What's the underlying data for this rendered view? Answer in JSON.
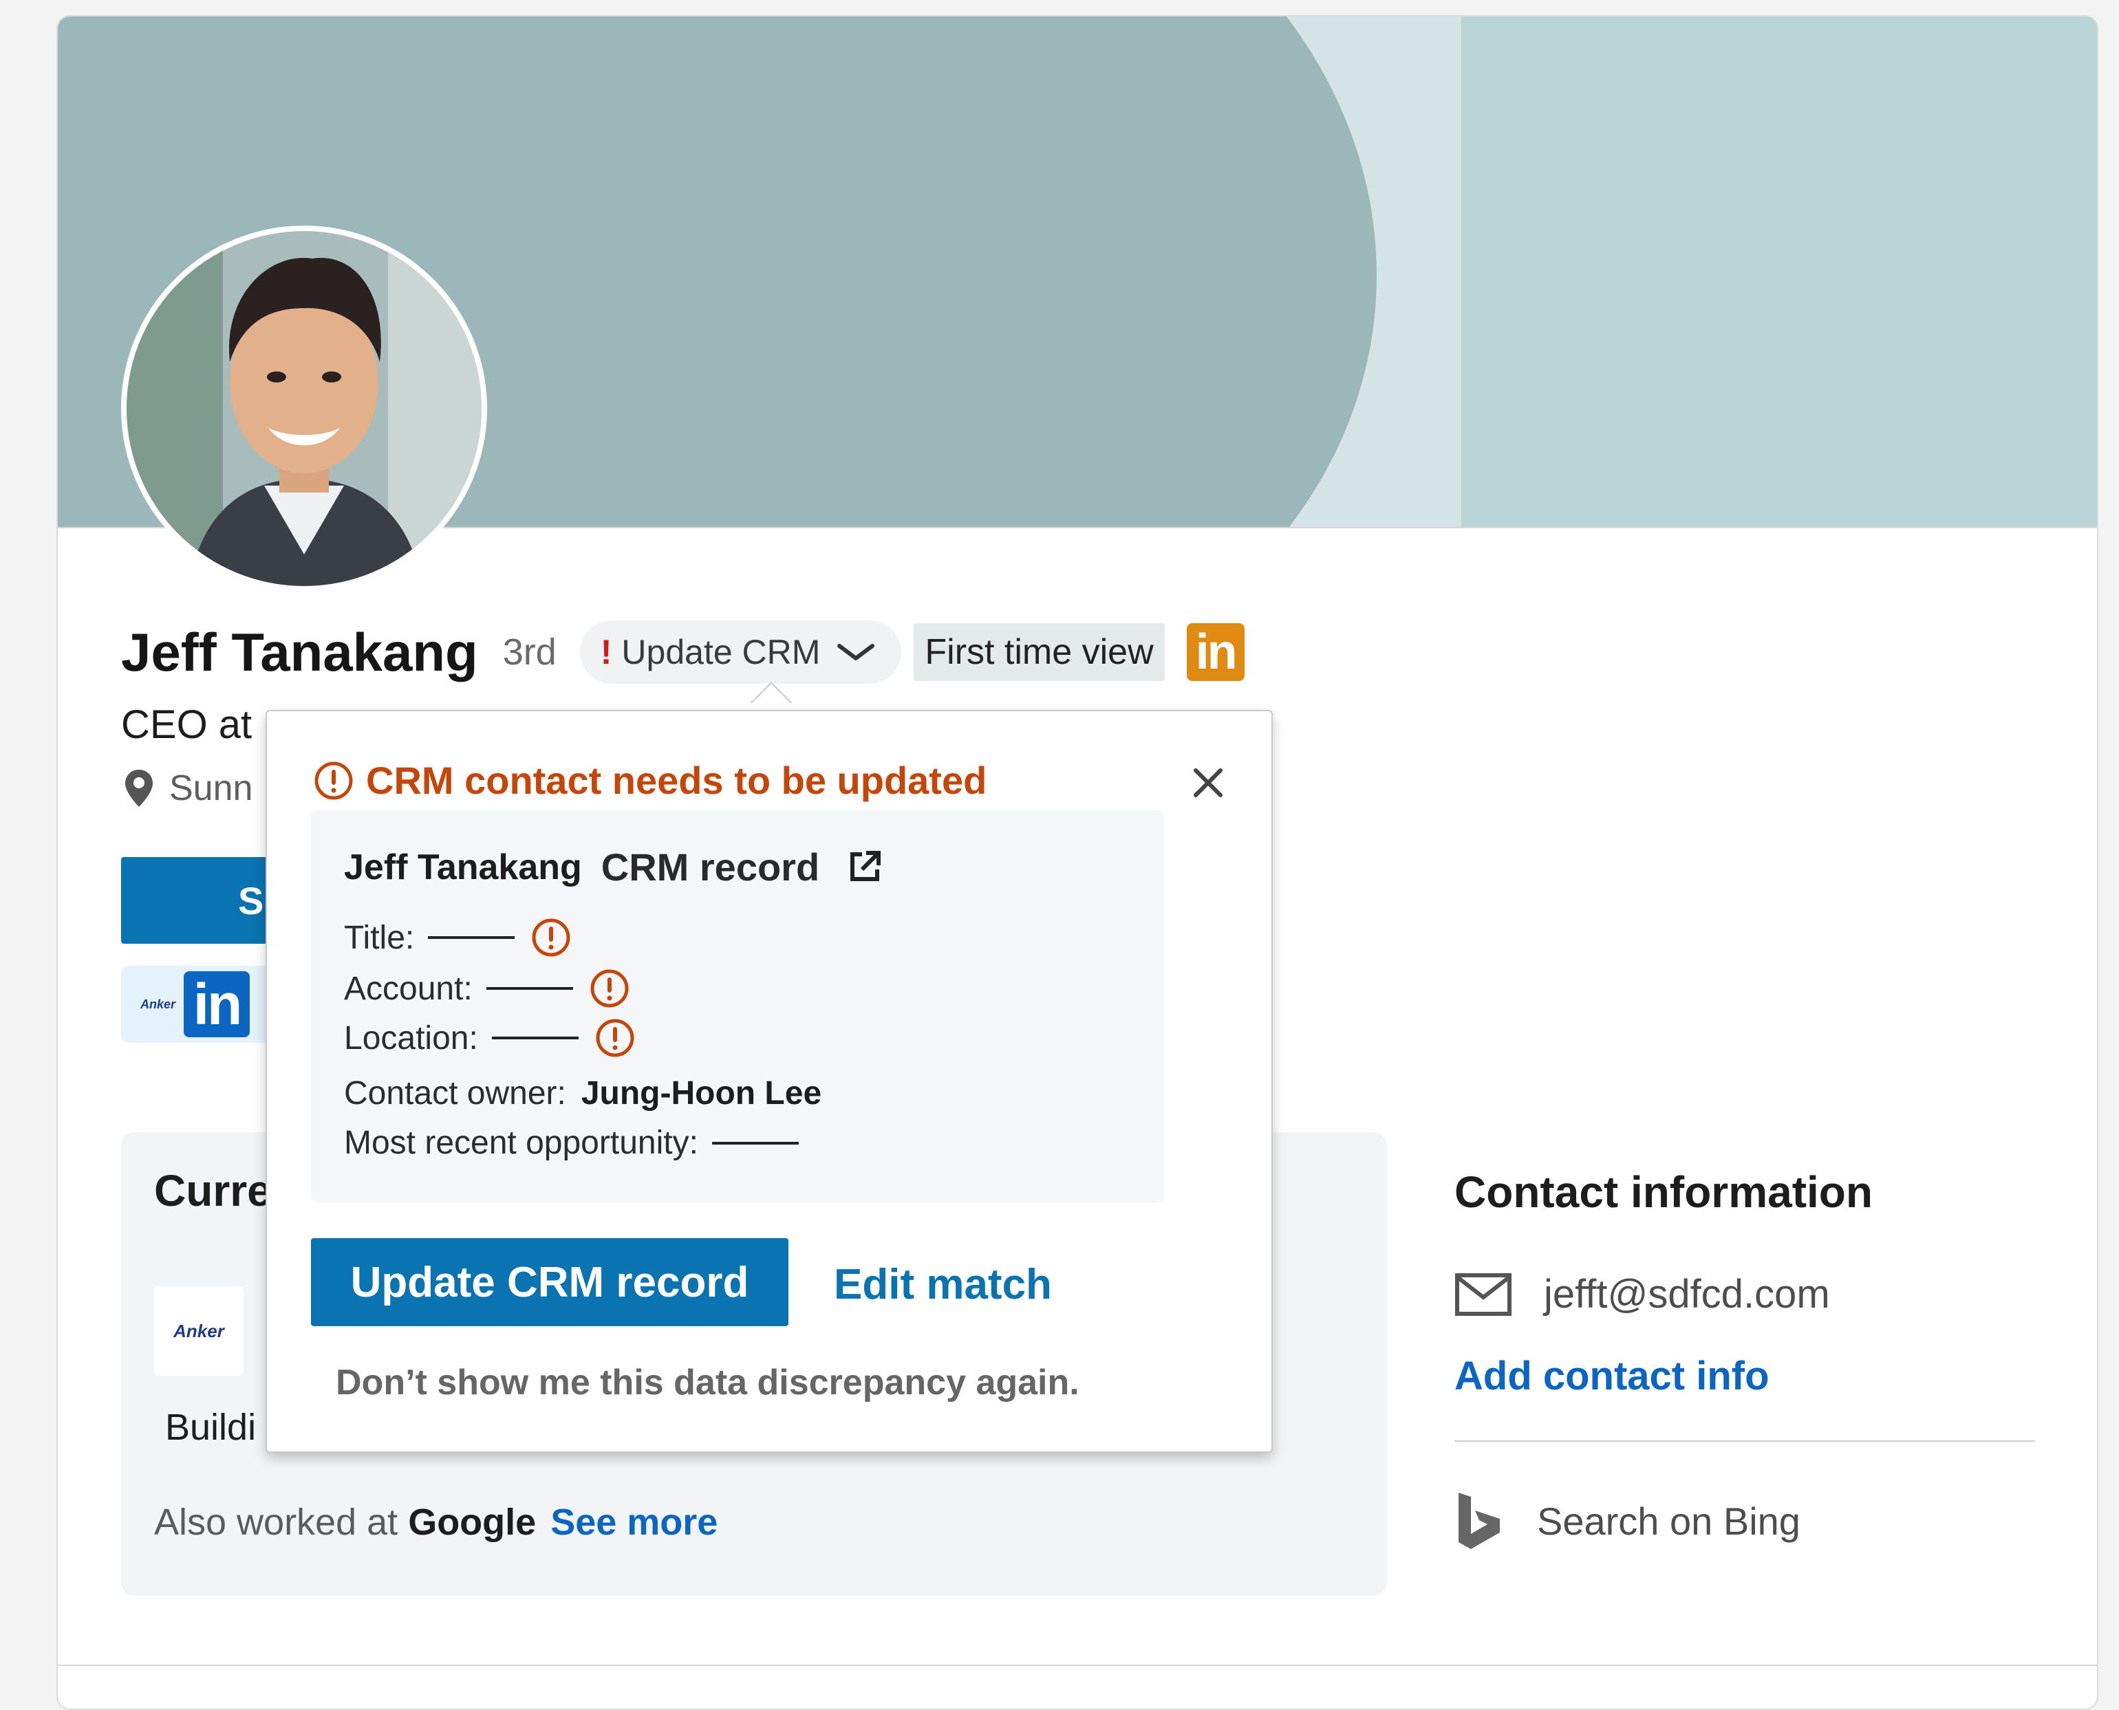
{
  "profile": {
    "name": "Jeff Tanakang",
    "degree": "3rd",
    "crm_button": {
      "alert": "!",
      "label": "Update CRM"
    },
    "first_time_view": "First time view",
    "linkedin_badge": "in",
    "headline": "CEO at",
    "location": "Sunn",
    "primary_button_label": "S",
    "company_logo_text": "Anker",
    "linkedin_small": "in"
  },
  "current_section": {
    "title": "Curre",
    "company_logo_text": "Anker",
    "description": "Buildi",
    "also_worked_prefix": "Also worked at",
    "also_worked_company": "Google",
    "see_more": "See more"
  },
  "contact": {
    "title": "Contact information",
    "email": "jefft@sdfcd.com",
    "add_contact": "Add contact info",
    "search_bing": "Search on Bing"
  },
  "popover": {
    "title": "CRM contact needs to be updated",
    "record_name": "Jeff Tanakang",
    "record_label": "CRM record",
    "fields": {
      "title_label": "Title:",
      "account_label": "Account:",
      "location_label": "Location:",
      "contact_owner_label": "Contact owner:",
      "contact_owner_value": "Jung-Hoon Lee",
      "opportunity_label": "Most recent opportunity:"
    },
    "update_button": "Update CRM record",
    "edit_match": "Edit match",
    "dont_show": "Don’t show me this data discrepancy again."
  },
  "colors": {
    "banner_dark": "#9cb7b9",
    "banner_mid": "#d4e4e6",
    "banner_light": "#bad5d7",
    "primary_blue": "#0a73b1",
    "link_blue": "#0a66c2",
    "warning_orange": "#c6460a",
    "linkedin_badge_orange": "#e08a12"
  }
}
